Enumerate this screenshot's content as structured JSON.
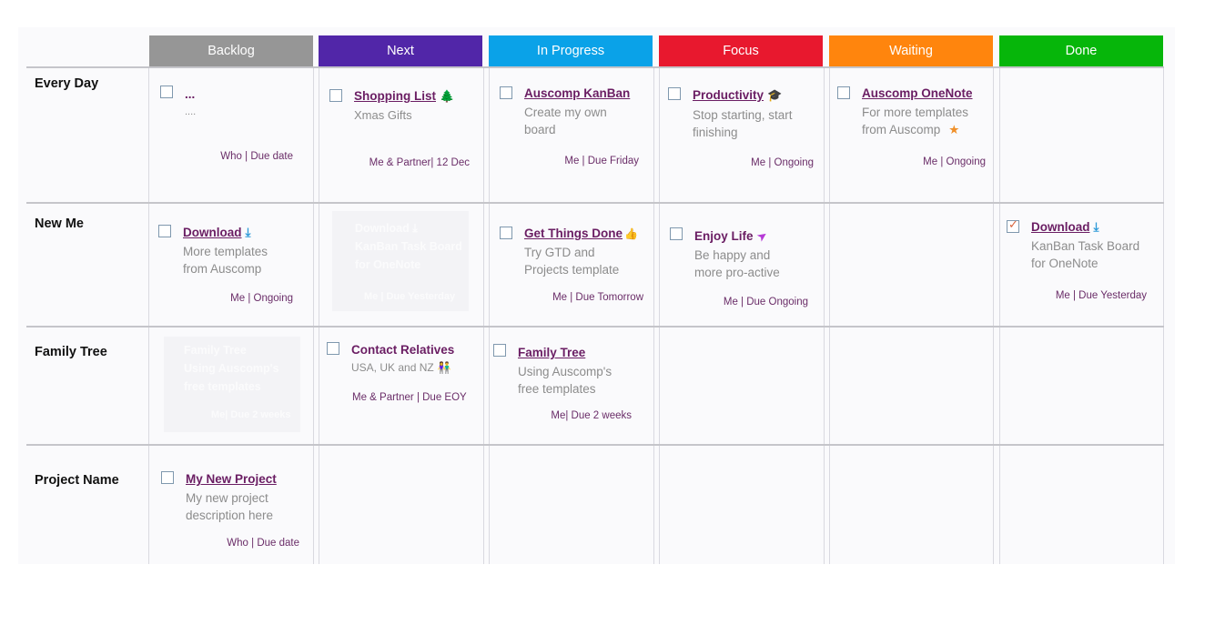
{
  "columns": [
    {
      "label": "Backlog",
      "color": "#969696"
    },
    {
      "label": "Next",
      "color": "#5126a8"
    },
    {
      "label": "In Progress",
      "color": "#0aa2e8"
    },
    {
      "label": "Focus",
      "color": "#e8182e"
    },
    {
      "label": "Waiting",
      "color": "#ff850d"
    },
    {
      "label": "Done",
      "color": "#06b60a"
    }
  ],
  "rows": [
    {
      "label": "Every Day"
    },
    {
      "label": "New Me"
    },
    {
      "label": "Family Tree"
    },
    {
      "label": "Project Name"
    }
  ],
  "cards": {
    "everyday_backlog": {
      "title": "...",
      "desc": "....",
      "meta": "Who  |  Due date",
      "checked": false
    },
    "everyday_next": {
      "title": "Shopping List",
      "icon": "christmas-tree-icon",
      "desc": "Xmas Gifts",
      "meta": "Me & Partner| 12 Dec",
      "checked": false
    },
    "everyday_inprogress": {
      "title": "Auscomp KanBan",
      "desc1": "Create my own",
      "desc2": "board",
      "meta": "Me  |  Due Friday",
      "checked": false
    },
    "everyday_focus": {
      "title": "Productivity",
      "icon": "graduation-cap-icon",
      "desc1": "Stop starting, start",
      "desc2": "finishing",
      "meta": "Me | Ongoing",
      "checked": false
    },
    "everyday_waiting": {
      "title": "Auscomp OneNote",
      "desc1": "For more templates",
      "desc2": "from Auscomp",
      "icon": "star-icon",
      "meta": "Me | Ongoing",
      "checked": false
    },
    "newme_backlog": {
      "title": "Download",
      "icon": "download-icon",
      "desc1": "More templates",
      "desc2": "from Auscomp",
      "meta": "Me | Ongoing",
      "checked": false
    },
    "newme_inprogress": {
      "title": "Get Things Done",
      "icon": "thumbs-up-icon",
      "desc1": "Try GTD and",
      "desc2": "Projects template",
      "meta": "Me  |  Due Tomorrow",
      "checked": false
    },
    "newme_focus": {
      "title": "Enjoy Life",
      "icon": "paper-plane-icon",
      "desc1": "Be happy and",
      "desc2": "more pro-active",
      "meta": "Me  |  Due Ongoing",
      "checked": false
    },
    "newme_done": {
      "title": "Download",
      "icon": "download-icon",
      "desc1": "KanBan Task Board",
      "desc2": "for OneNote",
      "meta": "Me  |  Due Yesterday",
      "checked": true
    },
    "family_next": {
      "title": "Contact Relatives",
      "desc": "USA, UK and NZ",
      "icon": "family-icon",
      "meta": "Me & Partner  |  Due EOY",
      "checked": false
    },
    "family_inprogress": {
      "title": "Family Tree",
      "desc1": "Using Auscomp's",
      "desc2": "free templates",
      "meta": "Me|  Due 2 weeks",
      "checked": false
    },
    "project_backlog": {
      "title": "My New Project",
      "desc1": "My new project",
      "desc2": "description here",
      "meta": "Who  |  Due date",
      "checked": false
    }
  },
  "ghosts": {
    "next_newme": {
      "l1": "Download ⤓",
      "l2": "KanBan Task Board",
      "l3": "for OneNote",
      "meta": "Me  |  Due Yesterday"
    },
    "backlog_family": {
      "l1": "Family Tree",
      "l2": "Using Auscomp's",
      "l3": "free templates",
      "meta": "Me|  Due 2 weeks"
    }
  },
  "icons": {
    "christmas-tree-icon": "🌲",
    "graduation-cap-icon": "🎓",
    "star-icon": "★",
    "download-icon": "⤓",
    "thumbs-up-icon": "👍",
    "paper-plane-icon": "➤",
    "family-icon": "👫"
  }
}
